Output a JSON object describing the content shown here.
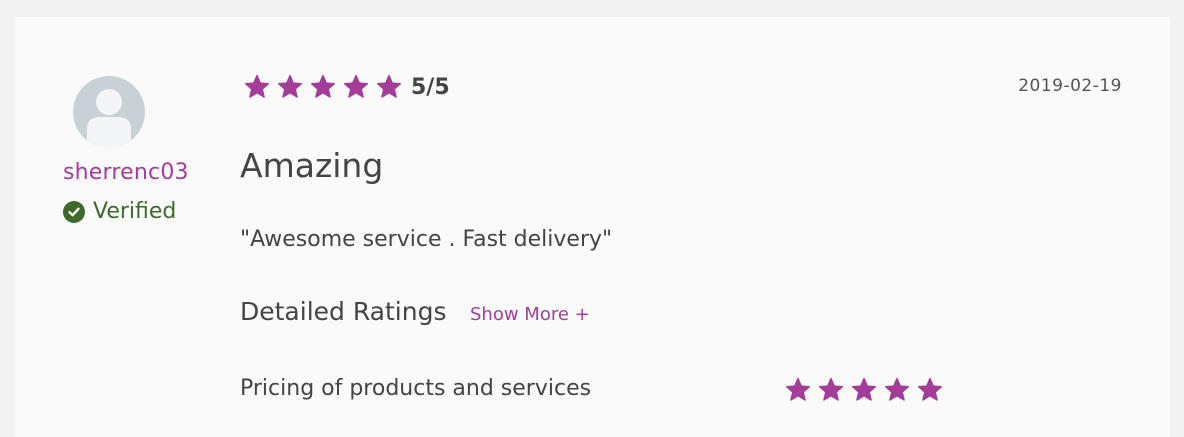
{
  "reviewer": {
    "username": "sherrenc03",
    "verified_label": "Verified"
  },
  "review": {
    "rating": 5,
    "rating_max": 5,
    "rating_text": "5/5",
    "date": "2019-02-19",
    "title": "Amazing",
    "body": "\"Awesome service . Fast delivery\""
  },
  "detailed_ratings": {
    "heading": "Detailed Ratings",
    "show_more_label": "Show More +",
    "items": [
      {
        "label": "Pricing of products and services",
        "rating": 5
      }
    ]
  },
  "colors": {
    "accent": "#a43d97",
    "verified": "#3e6b2a",
    "text": "#444444"
  },
  "icons": {
    "avatar": "user-placeholder-icon",
    "verified": "check-circle-icon",
    "star": "star-icon"
  }
}
